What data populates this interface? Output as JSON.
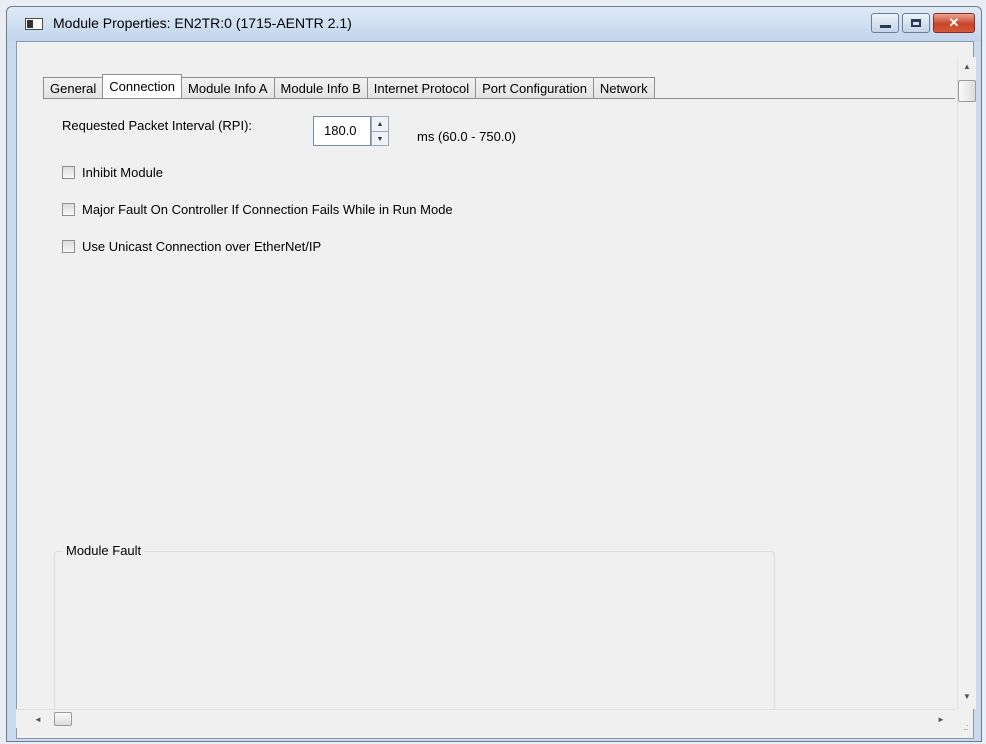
{
  "window": {
    "title": "Module Properties: EN2TR:0 (1715-AENTR 2.1)",
    "icons": {
      "app": "window-icon",
      "minimize": "minimize-icon",
      "maximize": "maximize-icon",
      "close": "close-icon"
    },
    "close_glyph": "✕"
  },
  "tabs": [
    {
      "label": "General",
      "active": false
    },
    {
      "label": "Connection",
      "active": true
    },
    {
      "label": "Module Info A",
      "active": false
    },
    {
      "label": "Module Info B",
      "active": false
    },
    {
      "label": "Internet Protocol",
      "active": false
    },
    {
      "label": "Port Configuration",
      "active": false
    },
    {
      "label": "Network",
      "active": false
    }
  ],
  "connection": {
    "rpi_label": "Requested Packet Interval (RPI):",
    "rpi_value": "180.0",
    "rpi_range": "ms (60.0 - 750.0)",
    "checkboxes": [
      {
        "label": "Inhibit Module",
        "checked": false
      },
      {
        "label": "Major Fault On Controller If Connection Fails While in Run Mode",
        "checked": false
      },
      {
        "label": "Use Unicast Connection over EtherNet/IP",
        "checked": false
      }
    ],
    "module_fault_label": "Module Fault"
  },
  "scrollbars": {
    "up": "▲",
    "down": "▼",
    "left": "◄",
    "right": "►",
    "grip": "..:"
  }
}
